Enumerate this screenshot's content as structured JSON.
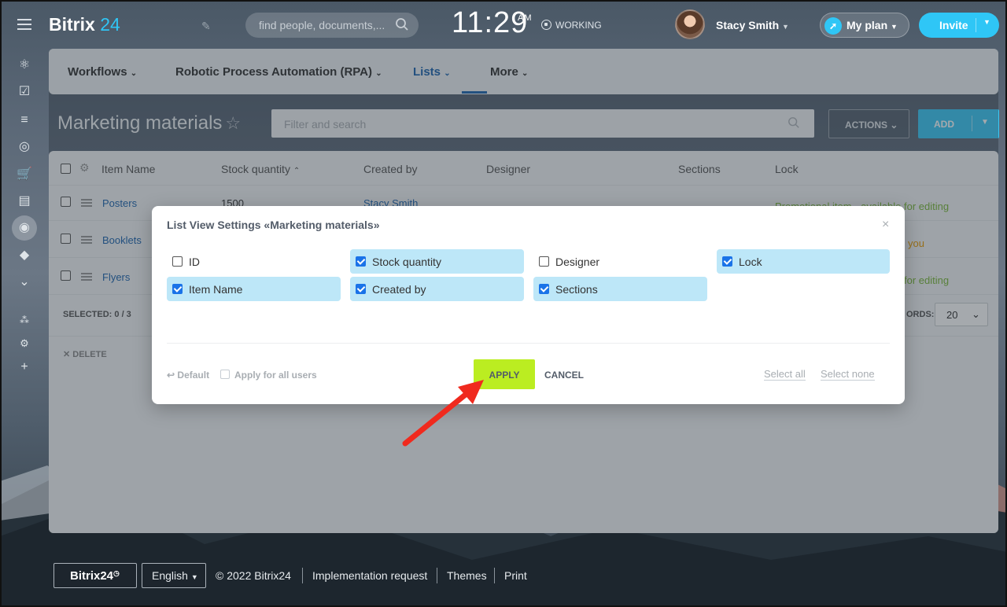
{
  "header": {
    "logo_name": "Bitrix",
    "logo_num": "24",
    "search_placeholder": "find people, documents,...",
    "clock": "11:29",
    "clock_ampm": "AM",
    "status": "WORKING",
    "user_name": "Stacy Smith",
    "plan_label": "My plan",
    "invite_label": "Invite"
  },
  "nav": {
    "items": [
      "Workflows",
      "Robotic Process Automation (RPA)",
      "Lists",
      "More"
    ],
    "selected": "Lists"
  },
  "page": {
    "title": "Marketing materials",
    "filter_placeholder": "Filter and search",
    "actions_label": "ACTIONS",
    "add_label": "ADD"
  },
  "grid": {
    "columns": [
      "Item Name",
      "Stock quantity",
      "Created by",
      "Designer",
      "Sections",
      "Lock"
    ],
    "rows": [
      {
        "name": "Posters",
        "qty": "1500",
        "created_by": "Stacy Smith",
        "lock": "Promotional item - available for editing",
        "lock_color": "#7ab839"
      },
      {
        "name": "Booklets",
        "qty": "",
        "created_by": "",
        "lock": "you",
        "lock_color": "#e89b00"
      },
      {
        "name": "Flyers",
        "qty": "",
        "created_by": "",
        "lock": "for editing",
        "lock_color": "#7ab839"
      }
    ],
    "selected_info": "SELECTED: 0 / 3",
    "records_label": "ORDS:",
    "page_size": "20",
    "delete_label": "DELETE"
  },
  "modal": {
    "title": "List View Settings «Marketing materials»",
    "options": [
      {
        "label": "ID",
        "checked": false
      },
      {
        "label": "Stock quantity",
        "checked": true
      },
      {
        "label": "Designer",
        "checked": false
      },
      {
        "label": "Lock",
        "checked": true
      },
      {
        "label": "Item Name",
        "checked": true
      },
      {
        "label": "Created by",
        "checked": true
      },
      {
        "label": "Sections",
        "checked": true
      }
    ],
    "default_label": "Default",
    "apply_all_label": "Apply for all users",
    "apply_label": "APPLY",
    "cancel_label": "CANCEL",
    "select_all_label": "Select all",
    "select_none_label": "Select none"
  },
  "footer": {
    "logo": "Bitrix24",
    "language": "English",
    "copyright": "© 2022 Bitrix24",
    "links": [
      "Implementation request",
      "Themes",
      "Print"
    ]
  },
  "colors": {
    "accent": "#2fc6f6",
    "apply_button": "#bbed21",
    "checked_option_bg": "#bde7f8",
    "annotation_arrow": "#f02a1e"
  },
  "icons": [
    "menu-icon",
    "pencil-icon",
    "search-icon",
    "status-icon",
    "rocket-icon",
    "star-icon",
    "gear-icon",
    "close-icon",
    "chevron-down-icon",
    "drag-handle-icon"
  ]
}
